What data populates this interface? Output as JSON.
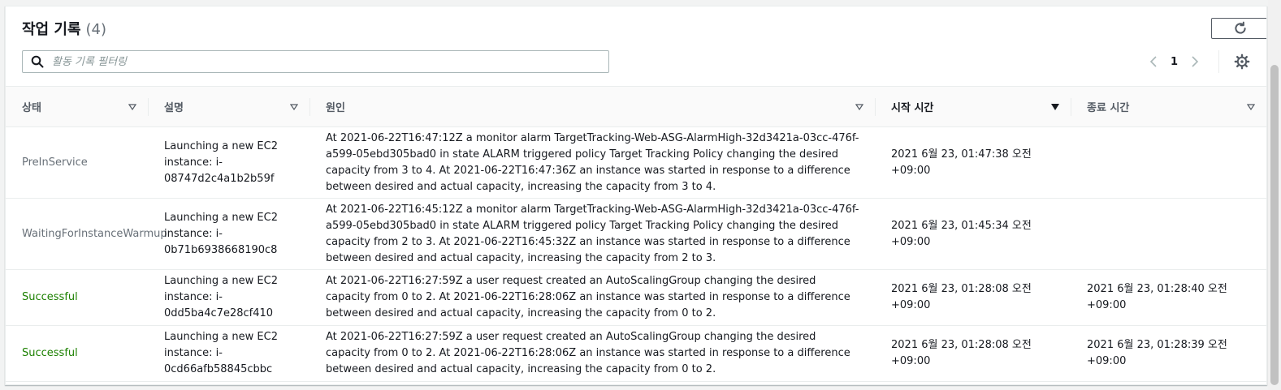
{
  "header": {
    "title": "작업 기록",
    "count": "(4)"
  },
  "search": {
    "placeholder": "활동 기록 필터링"
  },
  "pagination": {
    "current_page": "1"
  },
  "columns": [
    {
      "label": "상태",
      "sort": "none"
    },
    {
      "label": "설명",
      "sort": "none"
    },
    {
      "label": "원인",
      "sort": "none"
    },
    {
      "label": "시작 시간",
      "sort": "descending"
    },
    {
      "label": "종료 시간",
      "sort": "none"
    }
  ],
  "rows": [
    {
      "status": "PreInService",
      "status_type": "muted",
      "description": "Launching a new EC2 instance: i-08747d2c4a1b2b59f",
      "cause": "At 2021-06-22T16:47:12Z a monitor alarm TargetTracking-Web-ASG-AlarmHigh-32d3421a-03cc-476f-a599-05ebd305bad0 in state ALARM triggered policy Target Tracking Policy changing the desired capacity from 3 to 4. At 2021-06-22T16:47:36Z an instance was started in response to a difference between desired and actual capacity, increasing the capacity from 3 to 4.",
      "start_time": "2021 6월 23, 01:47:38 오전 +09:00",
      "end_time": ""
    },
    {
      "status": "WaitingForInstanceWarmup",
      "status_type": "muted",
      "description": "Launching a new EC2 instance: i-0b71b6938668190c8",
      "cause": "At 2021-06-22T16:45:12Z a monitor alarm TargetTracking-Web-ASG-AlarmHigh-32d3421a-03cc-476f-a599-05ebd305bad0 in state ALARM triggered policy Target Tracking Policy changing the desired capacity from 2 to 3. At 2021-06-22T16:45:32Z an instance was started in response to a difference between desired and actual capacity, increasing the capacity from 2 to 3.",
      "start_time": "2021 6월 23, 01:45:34 오전 +09:00",
      "end_time": ""
    },
    {
      "status": "Successful",
      "status_type": "success",
      "description": "Launching a new EC2 instance: i-0dd5ba4c7e28cf410",
      "cause": "At 2021-06-22T16:27:59Z a user request created an AutoScalingGroup changing the desired capacity from 0 to 2. At 2021-06-22T16:28:06Z an instance was started in response to a difference between desired and actual capacity, increasing the capacity from 0 to 2.",
      "start_time": "2021 6월 23, 01:28:08 오전 +09:00",
      "end_time": "2021 6월 23, 01:28:40 오전 +09:00"
    },
    {
      "status": "Successful",
      "status_type": "success",
      "description": "Launching a new EC2 instance: i-0cd66afb58845cbbc",
      "cause": "At 2021-06-22T16:27:59Z a user request created an AutoScalingGroup changing the desired capacity from 0 to 2. At 2021-06-22T16:28:06Z an instance was started in response to a difference between desired and actual capacity, increasing the capacity from 0 to 2.",
      "start_time": "2021 6월 23, 01:28:08 오전 +09:00",
      "end_time": "2021 6월 23, 01:28:39 오전 +09:00"
    }
  ],
  "icons": {
    "refresh": "refresh-icon",
    "search": "search-icon",
    "prev": "chevron-left-icon",
    "next": "chevron-right-icon",
    "settings": "gear-icon",
    "sort": "caret-down-icon"
  },
  "colors": {
    "success": "#1d8102",
    "muted": "#687078"
  }
}
